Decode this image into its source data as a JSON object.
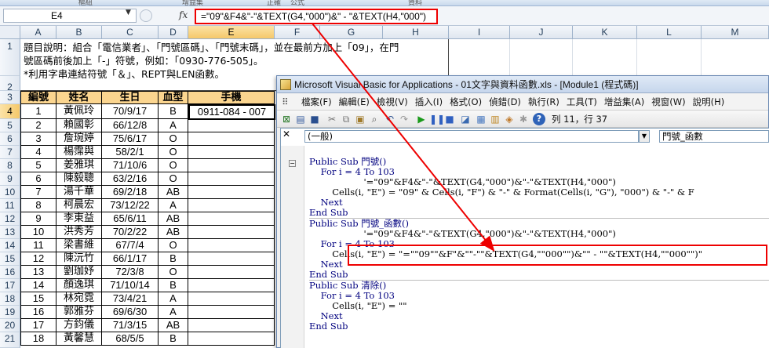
{
  "ribbon": {
    "labels": [
      "樞紐",
      "增益集",
      "正確",
      "公式",
      "資料"
    ]
  },
  "formula_bar": {
    "name_box": "E4",
    "fx": "fx",
    "formula": "=\"09\"&F4&\"-\"&TEXT(G4,\"000\")&\" - \"&TEXT(H4,\"000\")"
  },
  "sheet": {
    "columns": [
      "A",
      "B",
      "C",
      "D",
      "E",
      "F",
      "G",
      "H",
      "I",
      "J",
      "K",
      "L",
      "M"
    ],
    "rows": [
      "1",
      "2",
      "3",
      "4",
      "5",
      "6",
      "7",
      "8",
      "9",
      "10",
      "11",
      "12",
      "13",
      "14",
      "15",
      "16",
      "17",
      "18",
      "19",
      "20",
      "21"
    ],
    "description": [
      "題目說明：組合「電信業者」、「門號區碼」、「門號末碼」，並在最前方加上「09」，在門",
      "號區碼前後加上「-」符號，例如：「0930-776-505」。",
      "*利用字串連結符號「＆」、REPT與LEN函數。"
    ],
    "table_headers": [
      "編號",
      "姓名",
      "生日",
      "血型",
      "手機"
    ],
    "table_rows": [
      [
        "1",
        "黃佩玲",
        "70/9/17",
        "B"
      ],
      [
        "2",
        "賴國彰",
        "66/12/8",
        "A"
      ],
      [
        "3",
        "詹琬婷",
        "75/6/17",
        "O"
      ],
      [
        "4",
        "楊霈與",
        "58/2/1",
        "O"
      ],
      [
        "5",
        "姜雅琪",
        "71/10/6",
        "O"
      ],
      [
        "6",
        "陳毅聰",
        "63/2/16",
        "O"
      ],
      [
        "7",
        "湯千華",
        "69/2/18",
        "AB"
      ],
      [
        "8",
        "柯晨宏",
        "73/12/22",
        "A"
      ],
      [
        "9",
        "李東益",
        "65/6/11",
        "AB"
      ],
      [
        "10",
        "洪秀芳",
        "70/2/22",
        "AB"
      ],
      [
        "11",
        "梁書維",
        "67/7/4",
        "O"
      ],
      [
        "12",
        "陳沅竹",
        "66/1/17",
        "B"
      ],
      [
        "13",
        "劉珈妤",
        "72/3/8",
        "O"
      ],
      [
        "14",
        "顏逸琪",
        "71/10/14",
        "B"
      ],
      [
        "15",
        "林宛霓",
        "73/4/21",
        "A"
      ],
      [
        "16",
        "郭雅芬",
        "69/6/30",
        "A"
      ],
      [
        "17",
        "方鈞儀",
        "71/3/15",
        "AB"
      ],
      [
        "18",
        "黃馨慧",
        "68/5/5",
        "B"
      ]
    ],
    "active_cell_value": "0911-084 - 007"
  },
  "vba": {
    "title": "Microsoft Visual Basic for Applications - 01文字與資料函數.xls - [Module1 (程式碼)]",
    "menus": [
      "檔案(F)",
      "編輯(E)",
      "檢視(V)",
      "插入(I)",
      "格式(O)",
      "偵錯(D)",
      "執行(R)",
      "工具(T)",
      "增益集(A)",
      "視窗(W)",
      "說明(H)"
    ],
    "cursor_position": "列 11，行 37",
    "object_combo": "(一般)",
    "procedure_combo": "門號_函數",
    "code_lines": [
      "Public Sub 門號()",
      "    For i = 4 To 103",
      "                   '=\"09\"&F4&\"-\"&TEXT(G4,\"000\")&\"-\"&TEXT(H4,\"000\")",
      "        Cells(i, \"E\") = \"09\" & Cells(i, \"F\") & \"-\" & Format(Cells(i, \"G\"), \"000\") & \"-\" & F",
      "    Next",
      "End Sub",
      "Public Sub 門號_函數()",
      "                   '=\"09\"&F4&\"-\"&TEXT(G4,\"000\")&\"-\"&TEXT(H4,\"000\")",
      "    For i = 4 To 103",
      "        Cells(i, \"E\") = \"=\"\"09\"\"&F\"&\"\"-\"\"&TEXT(G4,\"\"000\"\")&\"\" - \"\"&TEXT(H4,\"\"000\"\")\"",
      "    Next",
      "End Sub",
      "Public Sub 清除()",
      "    For i = 4 To 103",
      "        Cells(i, \"E\") = \"\"",
      "    Next",
      "End Sub"
    ]
  },
  "colors": {
    "table_header": "#fbd58f",
    "highlight": "#ee0000",
    "vba_keyword": "#00007f"
  }
}
